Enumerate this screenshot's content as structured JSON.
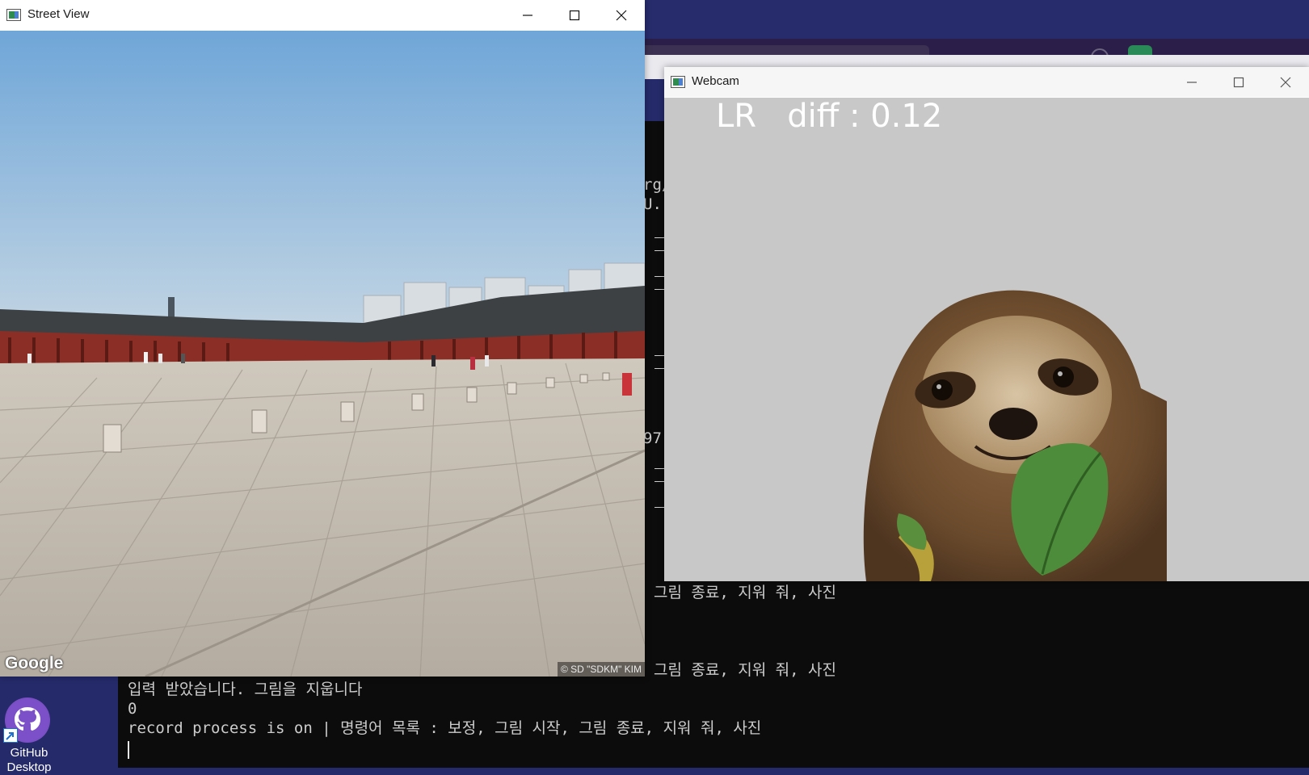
{
  "terminal": {
    "frag_top1": "rg/",
    "frag_top2": "U.",
    "frag_mid": "97'",
    "line_a_tail": "그림 종료, 지워 줘, 사진",
    "line_b_tail": "그림 종료, 지워 줘, 사진",
    "line1": "입력 받았습니다. 그림을 지웁니다",
    "line2": "0",
    "line3": "record process is on | 명령어 목록 : 보정, 그림 시작, 그림 종료, 지워 줘, 사진",
    "bg_color": "#0c0c0c",
    "text_color": "#cccccc"
  },
  "street_view": {
    "title": "Street View",
    "app_icon": "image-window-icon",
    "logo": "Google",
    "copyright": "© SD \"SDKM\" KIM",
    "controls": [
      "minimize-icon",
      "maximize-icon",
      "close-icon"
    ]
  },
  "webcam": {
    "title": "Webcam",
    "app_icon": "image-window-icon",
    "readout": "LR   diff : 0.12",
    "controls": [
      "minimize-icon",
      "maximize-icon",
      "close-icon"
    ],
    "bg_color": "#c8c8c8"
  },
  "desktop": {
    "icon_label": "GitHub",
    "icon_label_2": "Desktop",
    "icon_name": "github-icon",
    "wallpaper_color": "#252a6a"
  }
}
